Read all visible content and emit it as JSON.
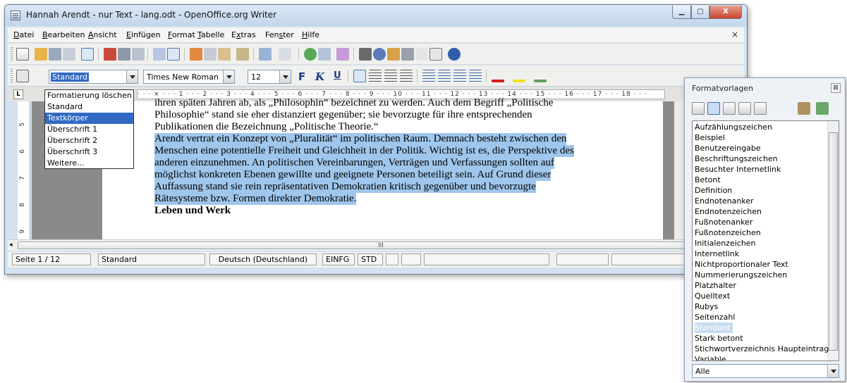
{
  "window": {
    "title": "Hannah Arendt - nur Text - lang.odt - OpenOffice.org Writer"
  },
  "menubar": {
    "items": [
      {
        "pre": "",
        "key": "D",
        "post": "atei"
      },
      {
        "pre": "",
        "key": "B",
        "post": "earbeiten"
      },
      {
        "pre": "",
        "key": "A",
        "post": "nsicht"
      },
      {
        "pre": "",
        "key": "E",
        "post": "infügen"
      },
      {
        "pre": "",
        "key": "F",
        "post": "ormat"
      },
      {
        "pre": "",
        "key": "T",
        "post": "abelle"
      },
      {
        "pre": "E",
        "key": "x",
        "post": "tras"
      },
      {
        "pre": "Fen",
        "key": "s",
        "post": "ter"
      },
      {
        "pre": "",
        "key": "H",
        "post": "ilfe"
      }
    ],
    "close_glyph": "×"
  },
  "formatting": {
    "style_value": "Standard",
    "font_value": "Times New Roman",
    "size_value": "12",
    "bold": "F",
    "italic": "K",
    "underline": "U"
  },
  "style_dropdown": {
    "items": [
      "Formatierung löschen",
      "Standard",
      "Textkörper",
      "Überschrift 1",
      "Überschrift 2",
      "Überschrift 3",
      "Weitere..."
    ],
    "highlighted_index": 2
  },
  "ruler": {
    "text": "· · · ⨯ · · · 1 · · · 2 · · · 3 · · · 4 · · · 5 · · · 6 · · · 7 · · · 8 · · · 9 · · · 10 · · · 11 · · · 12 · · · 13 · · · 14 · · · 15 · · · 16 · · · 17 · · · 18 · · ·"
  },
  "vruler": [
    "5",
    "6",
    "7",
    "8",
    "9"
  ],
  "document": {
    "lines": [
      {
        "text": "ihren späten Jahren ab, als „Philosophin“ bezeichnet zu werden. Auch dem Begriff „Politische",
        "selected": false
      },
      {
        "text": "Philosophie“ stand sie eher distanziert gegenüber; sie bevorzugte für ihre entsprechenden",
        "selected": false
      },
      {
        "text": "Publikationen die Bezeichnung „Politische Theorie.“",
        "selected": false
      },
      {
        "text": "Arendt vertrat ein Konzept von „Pluralität“ im politischen Raum. Demnach besteht zwischen den",
        "selected": true
      },
      {
        "text": "Menschen eine potentielle Freiheit und Gleichheit in der Politik. Wichtig ist es, die Perspektive des",
        "selected": true
      },
      {
        "text": "anderen einzunehmen. An politischen Vereinbarungen, Verträgen und Verfassungen sollten auf",
        "selected": true
      },
      {
        "text": "möglichst konkreten Ebenen gewillte und geeignete Personen beteiligt sein. Auf Grund dieser",
        "selected": true
      },
      {
        "text": "Auffassung stand sie rein repräsentativen Demokratien kritisch gegenüber und bevorzugte",
        "selected": true
      },
      {
        "text": "Rätesysteme bzw. Formen direkter Demokratie.",
        "selected": true
      },
      {
        "text": "Leben und Werk",
        "selected": false
      }
    ]
  },
  "hscroll": {
    "grip": "III"
  },
  "statusbar": {
    "page": "Seite 1 / 12",
    "style": "Standard",
    "language": "Deutsch (Deutschland)",
    "insert_mode": "EINFG",
    "selection_mode": "STD"
  },
  "styles_panel": {
    "title": "Formatvorlagen",
    "items": [
      "Aufzählungszeichen",
      "Beispiel",
      "Benutzereingabe",
      "Beschriftungszeichen",
      "Besuchter Internetlink",
      "Betont",
      "Definition",
      "Endnotenanker",
      "Endnotenzeichen",
      "Fußnotenanker",
      "Fußnotenzeichen",
      "Initialenzeichen",
      "Internetlink",
      "Nichtproportionaler Text",
      "Nummerierungszeichen",
      "Platzhalter",
      "Quelltext",
      "Rubys",
      "Seitenzahl",
      "Standard",
      "Stark betont",
      "Stichwortverzeichnis Haupteintrag",
      "Variable"
    ],
    "selected_index": 19,
    "filter_value": "Alle"
  },
  "colors": {
    "selection": "#9fc6ec",
    "highlight": "#316ac5",
    "page_background": "#8a8a8a"
  }
}
